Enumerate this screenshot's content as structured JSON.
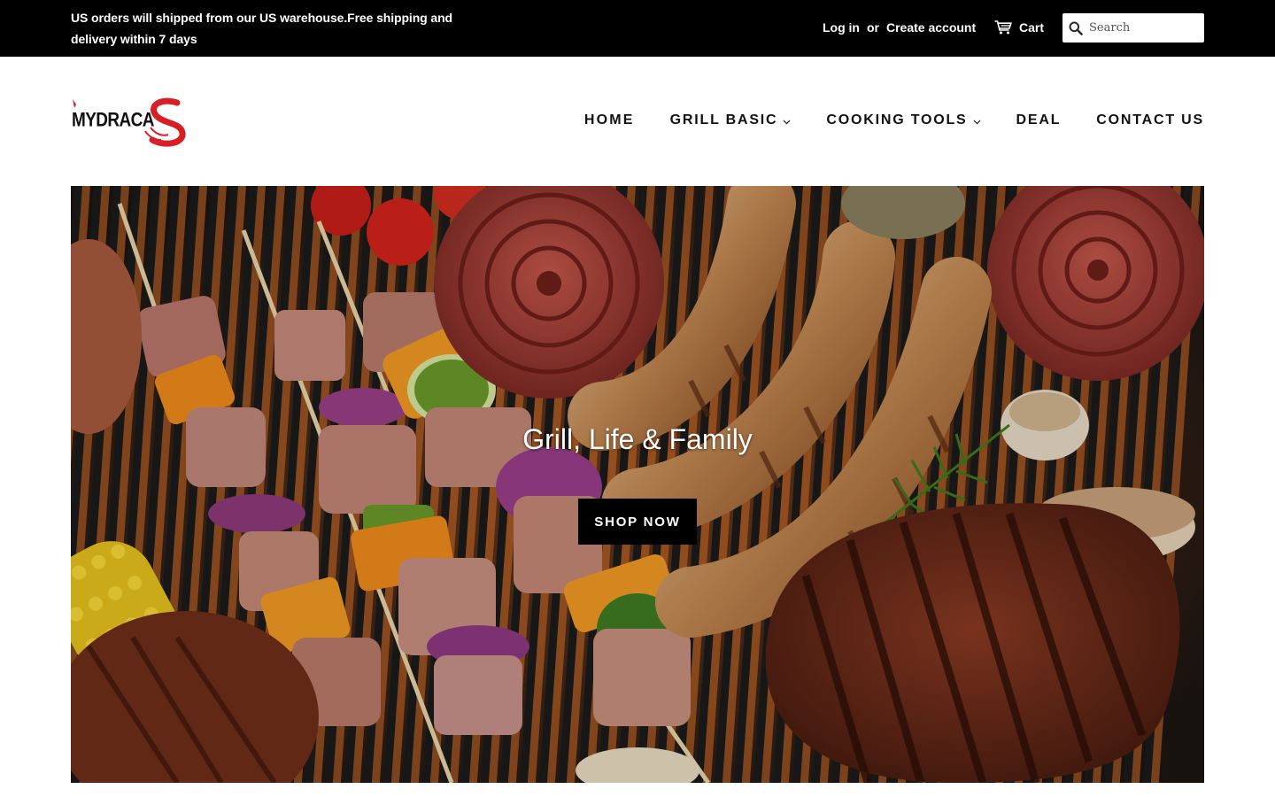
{
  "announcement": "US orders will shipped from our US warehouse.Free shipping and delivery within 7 days",
  "account": {
    "login": "Log in",
    "or": "or",
    "create": "Create account"
  },
  "cart": {
    "label": "Cart",
    "icon": "cart-icon"
  },
  "search": {
    "placeholder": "Search",
    "value": "",
    "icon": "search-icon"
  },
  "brand": {
    "logo_text": "MYDRACAS",
    "logo_colors": {
      "text": "#111111",
      "accent": "#d81f26"
    }
  },
  "nav": {
    "items": [
      {
        "label": "HOME",
        "active": true,
        "dropdown": false
      },
      {
        "label": "GRILL BASIC",
        "active": false,
        "dropdown": true
      },
      {
        "label": "COOKING TOOLS",
        "active": false,
        "dropdown": true
      },
      {
        "label": "DEAL",
        "active": false,
        "dropdown": false
      },
      {
        "label": "CONTACT US",
        "active": false,
        "dropdown": false
      }
    ]
  },
  "hero": {
    "title": "Grill, Life & Family",
    "button": "SHOP NOW"
  },
  "colors": {
    "topbar_bg": "#000000",
    "topbar_text": "#ffffff",
    "button_bg": "#000000"
  }
}
